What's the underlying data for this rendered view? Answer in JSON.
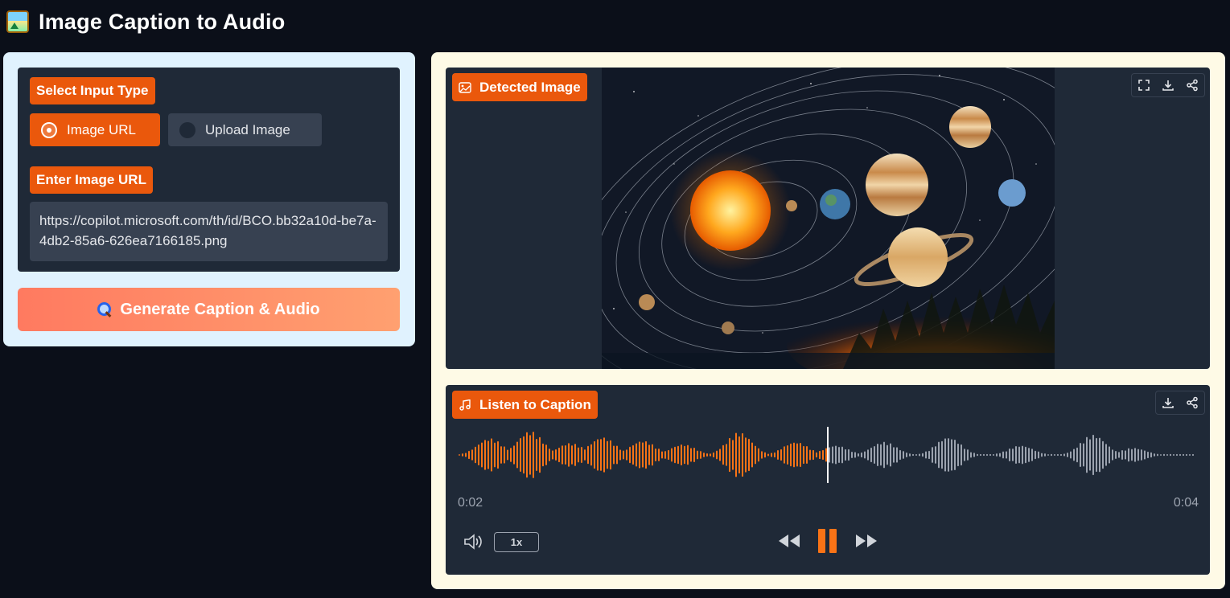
{
  "app": {
    "title": "Image Caption to Audio",
    "logo_icon": "framed-picture-icon"
  },
  "input": {
    "type_label": "Select Input Type",
    "options": [
      "Image URL",
      "Upload Image"
    ],
    "selected": "Image URL",
    "url_label": "Enter Image URL",
    "url_value": "https://copilot.microsoft.com/th/id/BCO.bb32a10d-be7a-4db2-85a6-626ea7166185.png",
    "generate_label": "Generate Caption & Audio",
    "generate_icon": "magnifying-glass-icon"
  },
  "image_output": {
    "label": "Detected Image",
    "tools": [
      "fullscreen-icon",
      "download-icon",
      "share-icon"
    ]
  },
  "audio_output": {
    "label": "Listen to Caption",
    "tools": [
      "download-icon",
      "share-icon"
    ],
    "current_time": "0:02",
    "duration": "0:04",
    "progress": 0.5,
    "speed": "1x"
  },
  "colors": {
    "accent": "#ea580c",
    "background": "#0b0f19",
    "card": "#1f2937",
    "left_panel": "#e0f2fe",
    "right_panel": "#fefae6",
    "wave_played": "#f97316",
    "wave_unplayed": "#9ca3af"
  }
}
